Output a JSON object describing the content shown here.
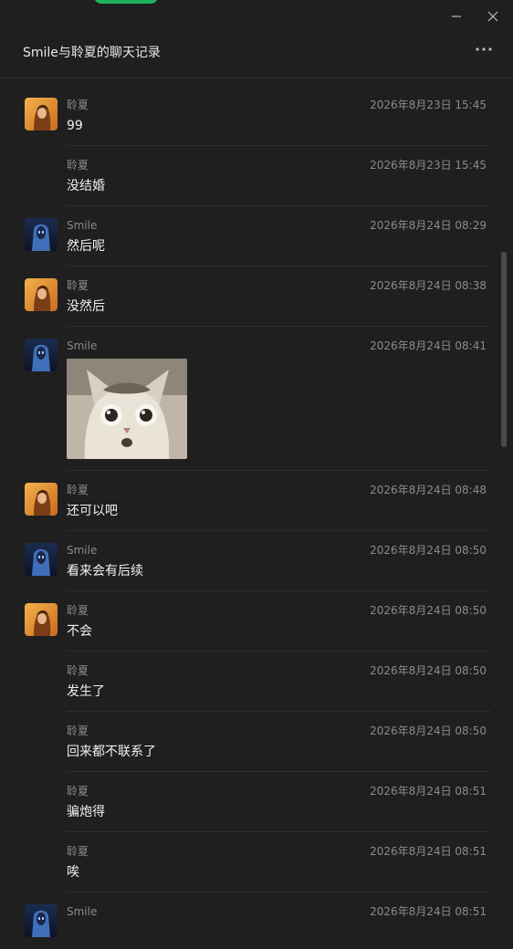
{
  "window": {
    "title": "Smile与聆夏的聊天记录",
    "icons": {
      "minimize": "minimize-icon",
      "close": "close-icon",
      "more": "more-icon"
    },
    "accent_color": "#1fb45a"
  },
  "messages": [
    {
      "sender": "聆夏",
      "time": "2026年8月23日 15:45",
      "type": "text",
      "text": "99",
      "show_avatar": true,
      "avatar": "avatar-linxia"
    },
    {
      "sender": "聆夏",
      "time": "2026年8月23日 15:45",
      "type": "text",
      "text": "没结婚",
      "show_avatar": false
    },
    {
      "sender": "Smile",
      "time": "2026年8月24日 08:29",
      "type": "text",
      "text": "然后呢",
      "show_avatar": true,
      "avatar": "avatar-smile"
    },
    {
      "sender": "聆夏",
      "time": "2026年8月24日 08:38",
      "type": "text",
      "text": "没然后",
      "show_avatar": true,
      "avatar": "avatar-linxia"
    },
    {
      "sender": "Smile",
      "time": "2026年8月24日 08:41",
      "type": "image",
      "image": "surprised-cat-sticker",
      "show_avatar": true,
      "avatar": "avatar-smile"
    },
    {
      "sender": "聆夏",
      "time": "2026年8月24日 08:48",
      "type": "text",
      "text": "还可以吧",
      "show_avatar": true,
      "avatar": "avatar-linxia"
    },
    {
      "sender": "Smile",
      "time": "2026年8月24日 08:50",
      "type": "text",
      "text": "看来会有后续",
      "show_avatar": true,
      "avatar": "avatar-smile"
    },
    {
      "sender": "聆夏",
      "time": "2026年8月24日 08:50",
      "type": "text",
      "text": "不会",
      "show_avatar": true,
      "avatar": "avatar-linxia"
    },
    {
      "sender": "聆夏",
      "time": "2026年8月24日 08:50",
      "type": "text",
      "text": "发生了",
      "show_avatar": false
    },
    {
      "sender": "聆夏",
      "time": "2026年8月24日 08:50",
      "type": "text",
      "text": "回来都不联系了",
      "show_avatar": false
    },
    {
      "sender": "聆夏",
      "time": "2026年8月24日 08:51",
      "type": "text",
      "text": "骗炮得",
      "show_avatar": false
    },
    {
      "sender": "聆夏",
      "time": "2026年8月24日 08:51",
      "type": "text",
      "text": "唉",
      "show_avatar": false
    },
    {
      "sender": "Smile",
      "time": "2026年8月24日 08:51",
      "type": "text",
      "text": "",
      "show_avatar": true,
      "avatar": "avatar-smile"
    }
  ]
}
